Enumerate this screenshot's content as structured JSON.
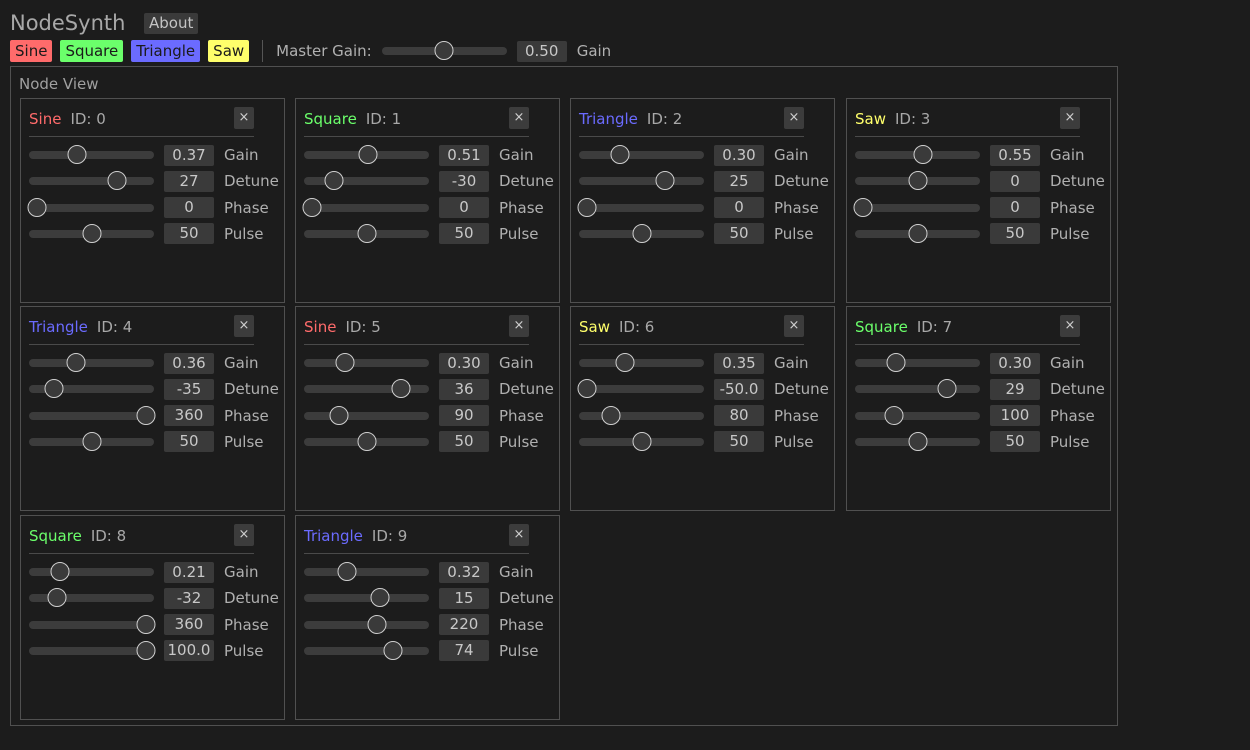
{
  "app": {
    "title": "NodeSynth",
    "about_label": "About"
  },
  "toolbar": {
    "waves": [
      {
        "label": "Sine",
        "color": "#ff6b6b"
      },
      {
        "label": "Square",
        "color": "#6bff6b"
      },
      {
        "label": "Triangle",
        "color": "#6b6bff"
      },
      {
        "label": "Saw",
        "color": "#ffff6b"
      }
    ],
    "master_gain_label": "Master Gain:",
    "master_gain_value": "0.50",
    "master_gain_fraction": 0.5,
    "master_gain_unit": "Gain"
  },
  "node_view": {
    "title": "Node View",
    "close_label": "×",
    "nodes": [
      {
        "type": "Sine",
        "id": "ID: 0",
        "color": "#ff6b6b",
        "params": [
          {
            "label": "Gain",
            "value": "0.37",
            "fraction": 0.37
          },
          {
            "label": "Detune",
            "value": "27",
            "fraction": 0.73
          },
          {
            "label": "Phase",
            "value": "0",
            "fraction": 0.0
          },
          {
            "label": "Pulse",
            "value": "50",
            "fraction": 0.5
          }
        ]
      },
      {
        "type": "Square",
        "id": "ID: 1",
        "color": "#6bff6b",
        "params": [
          {
            "label": "Gain",
            "value": "0.51",
            "fraction": 0.51
          },
          {
            "label": "Detune",
            "value": "-30",
            "fraction": 0.2
          },
          {
            "label": "Phase",
            "value": "0",
            "fraction": 0.0
          },
          {
            "label": "Pulse",
            "value": "50",
            "fraction": 0.5
          }
        ]
      },
      {
        "type": "Triangle",
        "id": "ID: 2",
        "color": "#6b6bff",
        "params": [
          {
            "label": "Gain",
            "value": "0.30",
            "fraction": 0.3
          },
          {
            "label": "Detune",
            "value": "25",
            "fraction": 0.72
          },
          {
            "label": "Phase",
            "value": "0",
            "fraction": 0.0
          },
          {
            "label": "Pulse",
            "value": "50",
            "fraction": 0.5
          }
        ]
      },
      {
        "type": "Saw",
        "id": "ID: 3",
        "color": "#ffff6b",
        "params": [
          {
            "label": "Gain",
            "value": "0.55",
            "fraction": 0.55
          },
          {
            "label": "Detune",
            "value": "0",
            "fraction": 0.5
          },
          {
            "label": "Phase",
            "value": "0",
            "fraction": 0.0
          },
          {
            "label": "Pulse",
            "value": "50",
            "fraction": 0.5
          }
        ]
      },
      {
        "type": "Triangle",
        "id": "ID: 4",
        "color": "#6b6bff",
        "params": [
          {
            "label": "Gain",
            "value": "0.36",
            "fraction": 0.36
          },
          {
            "label": "Detune",
            "value": "-35",
            "fraction": 0.16
          },
          {
            "label": "Phase",
            "value": "360",
            "fraction": 1.0
          },
          {
            "label": "Pulse",
            "value": "50",
            "fraction": 0.5
          }
        ]
      },
      {
        "type": "Sine",
        "id": "ID: 5",
        "color": "#ff6b6b",
        "params": [
          {
            "label": "Gain",
            "value": "0.30",
            "fraction": 0.3
          },
          {
            "label": "Detune",
            "value": "36",
            "fraction": 0.82
          },
          {
            "label": "Phase",
            "value": "90",
            "fraction": 0.25
          },
          {
            "label": "Pulse",
            "value": "50",
            "fraction": 0.5
          }
        ]
      },
      {
        "type": "Saw",
        "id": "ID: 6",
        "color": "#ffff6b",
        "params": [
          {
            "label": "Gain",
            "value": "0.35",
            "fraction": 0.35
          },
          {
            "label": "Detune",
            "value": "-50.0",
            "fraction": 0.0
          },
          {
            "label": "Phase",
            "value": "80",
            "fraction": 0.22
          },
          {
            "label": "Pulse",
            "value": "50",
            "fraction": 0.5
          }
        ]
      },
      {
        "type": "Square",
        "id": "ID: 7",
        "color": "#6bff6b",
        "params": [
          {
            "label": "Gain",
            "value": "0.30",
            "fraction": 0.3
          },
          {
            "label": "Detune",
            "value": "29",
            "fraction": 0.77
          },
          {
            "label": "Phase",
            "value": "100",
            "fraction": 0.28
          },
          {
            "label": "Pulse",
            "value": "50",
            "fraction": 0.5
          }
        ]
      },
      {
        "type": "Square",
        "id": "ID: 8",
        "color": "#6bff6b",
        "params": [
          {
            "label": "Gain",
            "value": "0.21",
            "fraction": 0.21
          },
          {
            "label": "Detune",
            "value": "-32",
            "fraction": 0.18
          },
          {
            "label": "Phase",
            "value": "360",
            "fraction": 1.0
          },
          {
            "label": "Pulse",
            "value": "100.0",
            "fraction": 1.0
          }
        ]
      },
      {
        "type": "Triangle",
        "id": "ID: 9",
        "color": "#6b6bff",
        "params": [
          {
            "label": "Gain",
            "value": "0.32",
            "fraction": 0.32
          },
          {
            "label": "Detune",
            "value": "15",
            "fraction": 0.62
          },
          {
            "label": "Phase",
            "value": "220",
            "fraction": 0.6
          },
          {
            "label": "Pulse",
            "value": "74",
            "fraction": 0.74
          }
        ]
      }
    ]
  }
}
